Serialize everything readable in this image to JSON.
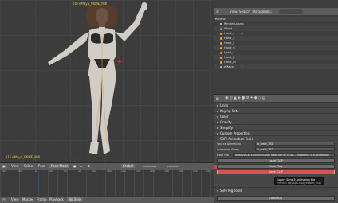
{
  "viewport": {
    "header_text": "(0) eMaya_96ME_Mdl",
    "object_label": "(1) eMaya_96ME_Mdl"
  },
  "view_header": {
    "view": "View",
    "select": "Select",
    "pose": "Pose",
    "mode": "Pose Mode",
    "pivot": "Global"
  },
  "timeline": {
    "ticks": [
      "-40",
      "-20",
      "0",
      "20",
      "40",
      "60",
      "80",
      "100",
      "120",
      "140",
      "160",
      "180",
      "200",
      "220",
      "240"
    ],
    "footer": {
      "view": "View",
      "marker": "Marker",
      "frame": "Frame",
      "playback": "Playback",
      "sync": "No Sync"
    }
  },
  "outliner": {
    "view": "View",
    "search": "Search",
    "scene": "All Scenes",
    "rows": [
      {
        "label": "Scene",
        "indent": 2
      },
      {
        "label": "RenderLayers",
        "indent": 6
      },
      {
        "label": "World",
        "indent": 6
      },
      {
        "label": "Hand_0",
        "indent": 6
      },
      {
        "label": "Hand_2",
        "indent": 6
      },
      {
        "label": "Hand_5",
        "indent": 6
      },
      {
        "label": "Hand_6",
        "indent": 6
      },
      {
        "label": "Hand_7",
        "indent": 6
      },
      {
        "label": "Hand_8",
        "indent": 6
      },
      {
        "label": "Hand_m",
        "indent": 6
      },
      {
        "label": "eMaya_",
        "indent": 6
      }
    ]
  },
  "properties": {
    "panels": [
      "Units",
      "Keying Sets",
      "Color",
      "Gravity",
      "Simplify",
      "Custom Properties"
    ],
    "s3pi_header": "S3PI Animation Tools",
    "source_label": "Source Animation",
    "source_value": "a_walk_TBD",
    "anim_name_label": "Animation Name",
    "anim_name_value": "a_walk_TBD",
    "base_file_label": "Base File",
    "base_file_value": "0x6B20C4F3 0x00000000 0x8E9AF5E7C4A... (jdakeyc\\TS3\\animation",
    "load_clip": "Load CLIP",
    "rush_play": "Rush Play",
    "save_clip": "Save CLIP",
    "rig_header": "S3PI Rig Tools",
    "load_rig": "Load Rig"
  },
  "tooltip": {
    "title": "Export Sims 3 Animation file",
    "line2": "Python: bpy.ops.s3py.export_clip()"
  },
  "colors": {
    "accent_red": "#d55353",
    "highlight_blue": "#4da0e6"
  }
}
